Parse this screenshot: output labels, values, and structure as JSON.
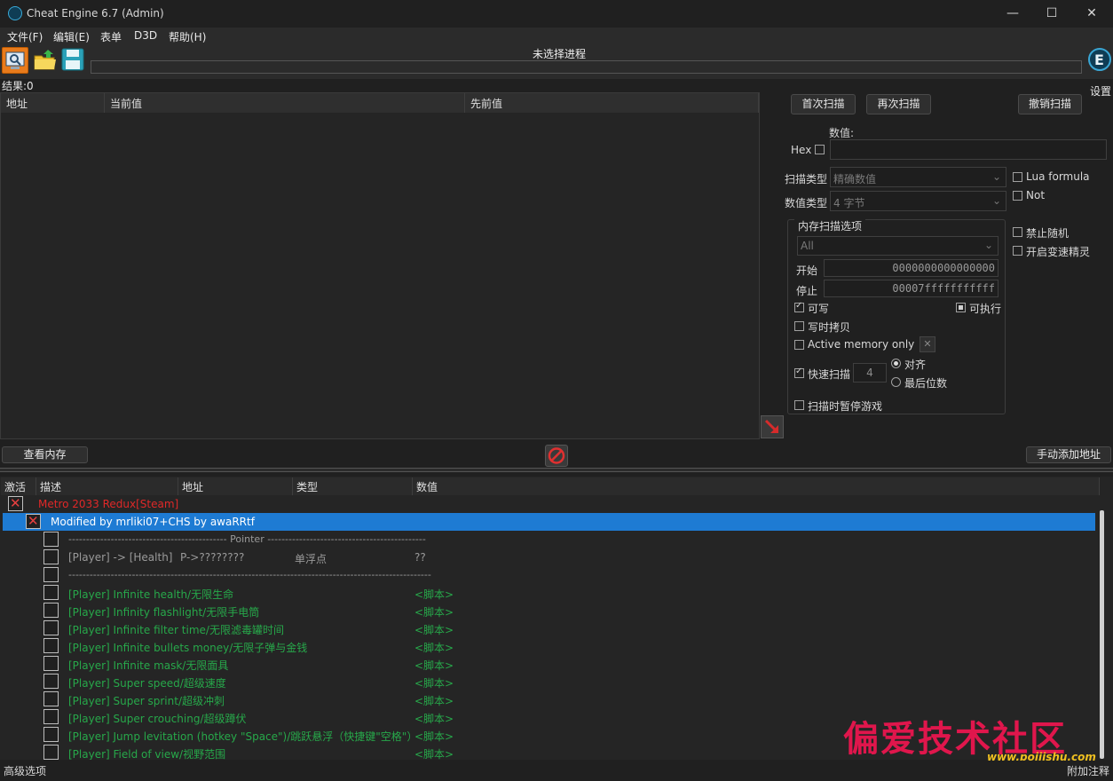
{
  "window": {
    "title": "Cheat Engine 6.7 (Admin)",
    "controls": {
      "minimize": "—",
      "maximize": "☐",
      "close": "✕"
    }
  },
  "menu": [
    "文件(F)",
    "编辑(E)",
    "表单",
    "D3D",
    "帮助(H)"
  ],
  "toolbar": {
    "process_label": "未选择进程",
    "open_process_icon": "open-process-icon",
    "open_file_icon": "open-folder-icon",
    "save_icon": "save-icon",
    "settings_label": "设置"
  },
  "results": {
    "label": "结果:0"
  },
  "scan_list": {
    "columns": [
      "地址",
      "当前值",
      "先前值"
    ]
  },
  "scan_panel": {
    "first_scan": "首次扫描",
    "next_scan": "再次扫描",
    "undo_scan": "撤销扫描",
    "value_label": "数值:",
    "hex_label": "Hex",
    "scan_type_label": "扫描类型",
    "scan_type_value": "精确数值",
    "value_type_label": "数值类型",
    "value_type_value": "4 字节",
    "lua_formula": "Lua formula",
    "not_label": "Not",
    "mem_options_title": "内存扫描选项",
    "region": "All",
    "start_label": "开始",
    "start_value": "0000000000000000",
    "stop_label": "停止",
    "stop_value": "00007fffffffffff",
    "writable": "可写",
    "executable": "可执行",
    "copy_on_write": "写时拷贝",
    "active_memory": "Active memory only",
    "fast_scan": "快速扫描",
    "fast_scan_value": "4",
    "align": "对齐",
    "last_digits": "最后位数",
    "pause_game": "扫描时暂停游戏",
    "disable_random": "禁止随机",
    "speedhack": "开启变速精灵"
  },
  "middle_bar": {
    "memory_view": "查看内存",
    "add_address": "手动添加地址"
  },
  "cheat_table": {
    "columns": [
      "激活",
      "描述",
      "地址",
      "类型",
      "数值"
    ],
    "rows": [
      {
        "desc": "Metro 2033 Redux[Steam]",
        "address": "",
        "type": "",
        "value": ""
      },
      {
        "desc": "Modified by mrliki07+CHS by awaRRtf",
        "address": "",
        "type": "",
        "value": ""
      },
      {
        "desc": "--------------------------------------------- Pointer ---------------------------------------------",
        "address": "",
        "type": "",
        "value": ""
      },
      {
        "desc": "[Player] -> [Health]",
        "address": "P->????????",
        "type": "单浮点",
        "value": "??"
      },
      {
        "desc": "-------------------------------------------------------------------------------------------------------",
        "address": "",
        "type": "",
        "value": ""
      },
      {
        "desc": "[Player] Infinite health/无限生命",
        "address": "",
        "type": "",
        "value": "<脚本>"
      },
      {
        "desc": "[Player] Infinity flashlight/无限手电筒",
        "address": "",
        "type": "",
        "value": "<脚本>"
      },
      {
        "desc": "[Player] Infinite filter time/无限滤毒罐时间",
        "address": "",
        "type": "",
        "value": "<脚本>"
      },
      {
        "desc": "[Player] Infinite bullets money/无限子弹与金钱",
        "address": "",
        "type": "",
        "value": "<脚本>"
      },
      {
        "desc": "[Player] Infinite mask/无限面具",
        "address": "",
        "type": "",
        "value": "<脚本>"
      },
      {
        "desc": "[Player] Super speed/超级速度",
        "address": "",
        "type": "",
        "value": "<脚本>"
      },
      {
        "desc": "[Player] Super sprint/超级冲刺",
        "address": "",
        "type": "",
        "value": "<脚本>"
      },
      {
        "desc": "[Player] Super crouching/超级蹲伏",
        "address": "",
        "type": "",
        "value": "<脚本>"
      },
      {
        "desc": "[Player] Jump levitation (hotkey \"Space\")/跳跃悬浮（快捷键\"空格\"）",
        "address": "",
        "type": "",
        "value": "<脚本>"
      },
      {
        "desc": "[Player] Field of view/视野范围",
        "address": "",
        "type": "",
        "value": "<脚本>"
      }
    ]
  },
  "statusbar": {
    "advanced": "高级选项",
    "comments": "附加注释"
  },
  "watermark": {
    "text": "偏爱技术社区",
    "url": "www.pojjishu.com"
  }
}
